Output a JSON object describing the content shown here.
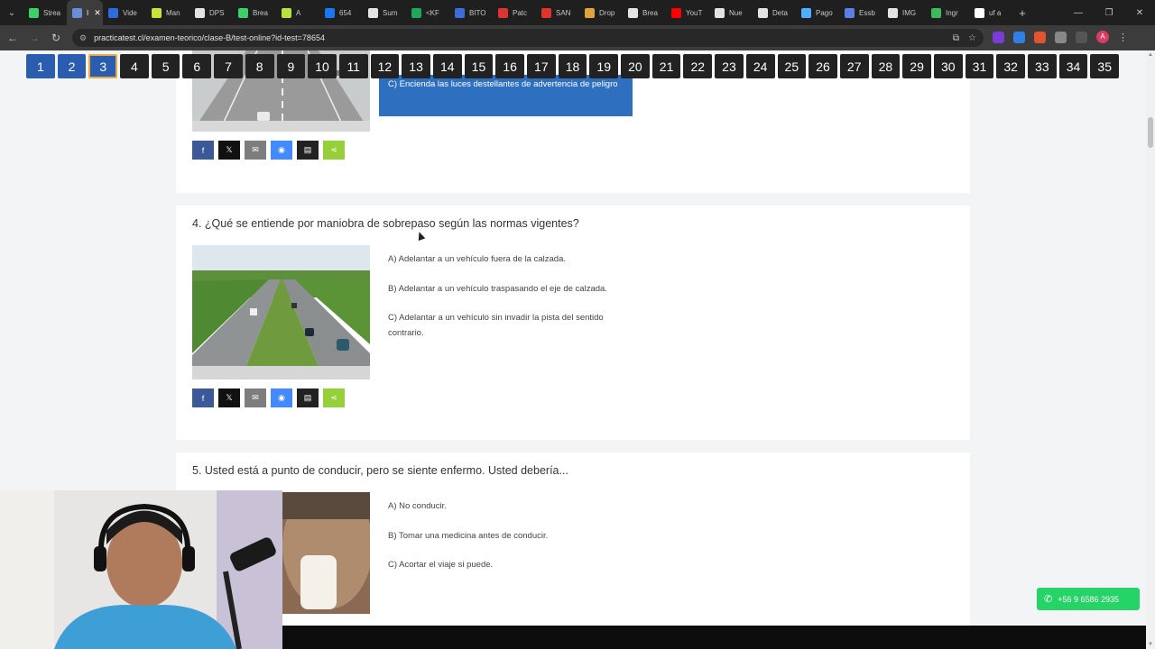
{
  "browser": {
    "tabs": [
      {
        "label": "Strea",
        "color": "#3dd068"
      },
      {
        "label": "I",
        "color": "#6b8fd6",
        "active": true
      },
      {
        "label": "Vide",
        "color": "#2d6cdf"
      },
      {
        "label": "Man",
        "color": "#c8e63a"
      },
      {
        "label": "DPS",
        "color": "#e3e3e3"
      },
      {
        "label": "Brea",
        "color": "#3dd068"
      },
      {
        "label": "A",
        "color": "#b6e23b"
      },
      {
        "label": "654",
        "color": "#1877f2"
      },
      {
        "label": "Sum",
        "color": "#e3e3e3"
      },
      {
        "label": "<KF",
        "color": "#1ea65a"
      },
      {
        "label": "BITO",
        "color": "#3b6cd9"
      },
      {
        "label": "Patc",
        "color": "#d33"
      },
      {
        "label": "SAN",
        "color": "#e0342a"
      },
      {
        "label": "Drop",
        "color": "#e0a23a"
      },
      {
        "label": "Brea",
        "color": "#e3e3e3"
      },
      {
        "label": "YouT",
        "color": "#ff0000"
      },
      {
        "label": "Nue",
        "color": "#e3e3e3"
      },
      {
        "label": "Deta",
        "color": "#e3e3e3"
      },
      {
        "label": "Pago",
        "color": "#4fb0ff"
      },
      {
        "label": "Essb",
        "color": "#5b7fe6"
      },
      {
        "label": "IMG",
        "color": "#e3e3e3"
      },
      {
        "label": "Ingr",
        "color": "#3dbb5a"
      },
      {
        "label": "uf a",
        "color": "#ffffff"
      }
    ],
    "url": "practicatest.cl/examen-teorico/clase-B/test-online?id-test=78654",
    "avatar_letter": "A"
  },
  "question_nav": {
    "numbers": [
      "1",
      "2",
      "3",
      "4",
      "5",
      "6",
      "7",
      "8",
      "9",
      "10",
      "11",
      "12",
      "13",
      "14",
      "15",
      "16",
      "17",
      "18",
      "19",
      "20",
      "21",
      "22",
      "23",
      "24",
      "25",
      "26",
      "27",
      "28",
      "29",
      "30",
      "31",
      "32",
      "33",
      "34",
      "35"
    ],
    "answered": [
      1,
      2
    ],
    "current": 3,
    "answered_color": "#2a5db0",
    "default_color": "#222222"
  },
  "q3": {
    "selected_option": "C) Encienda las luces destellantes de advertencia de peligro"
  },
  "q4": {
    "question": "4. ¿Qué se entiende por maniobra de sobrepaso según las normas vigentes?",
    "options": [
      "A) Adelantar a un vehículo fuera de la calzada.",
      "B) Adelantar a un vehículo traspasando el eje de calzada.",
      "C) Adelantar a un vehículo sin invadir la pista del sentido contrario."
    ]
  },
  "q5": {
    "question": "5. Usted está a punto de conducir, pero se siente enfermo. Usted debería...",
    "options": [
      "A) No conducir.",
      "B) Tomar una medicina antes de conducir.",
      "C) Acortar el viaje si puede."
    ]
  },
  "share_icons": [
    "facebook-icon",
    "x-icon",
    "email-icon",
    "messenger-icon",
    "print-icon",
    "share-icon"
  ],
  "whatsapp": {
    "label": "+56 9 6586 2935",
    "color": "#25d366"
  }
}
